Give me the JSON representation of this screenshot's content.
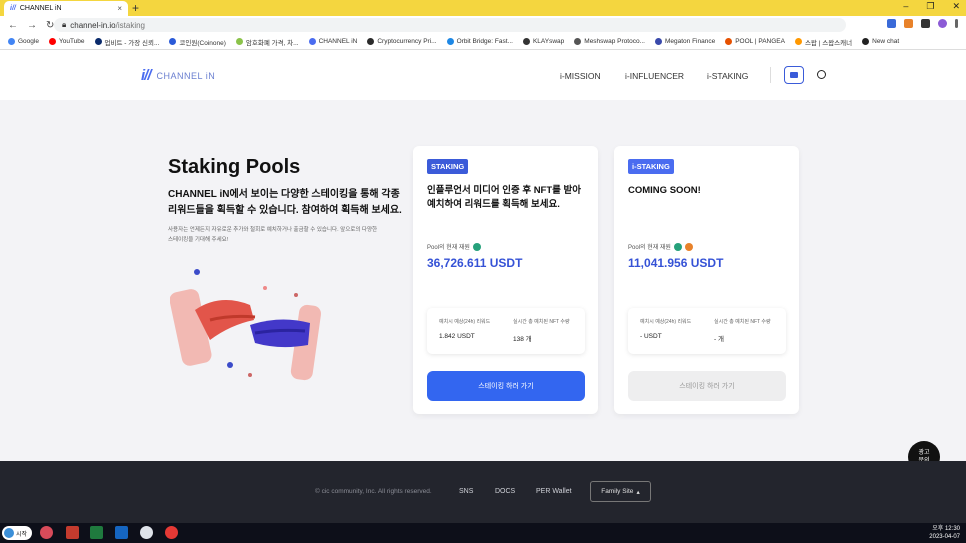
{
  "browser": {
    "tab_title": "CHANNEL iN",
    "tab_close": "×",
    "new_tab": "+",
    "url_host": "channel-in.io",
    "url_path": "/istaking",
    "bookmarks": [
      "Google",
      "YouTube",
      "업비트 - 가장 신뢰...",
      "코인원(Coinone)",
      "암호화폐 가격, 차...",
      "CHANNEL iN",
      "Cryptocurrency Pri...",
      "Orbit Bridge: Fast...",
      "KLAYswap",
      "Meshswap Protoco...",
      "Megaton Finance",
      "POOL | PANGEA",
      "스왑 | 스왑스캐너",
      "New chat"
    ]
  },
  "header": {
    "logo_mark": "i//",
    "logo_text": "CHANNEL iN",
    "nav": [
      "i-MISSION",
      "i-INFLUENCER",
      "i-STAKING"
    ]
  },
  "hero": {
    "title": "Staking Pools",
    "subtitle": "CHANNEL iN에서 보이는 다양한 스테이킹을 통해 각종 리워드들을 획득할 수 있습니다. 참여하여 획득해 보세요.",
    "note": "사용자는 언제든지 자유로운 추가와 철회로 예치하거나 출금할 수 있습니다. 앞으로의 다양한 스테이킹을 기대해 주세요!"
  },
  "cards": [
    {
      "badge": "STAKING",
      "badge_color": "#3b5bd9",
      "heading": "인플루언서 미디어 인증 후 NFT를 받아 예치하여 리워드를 획득해 보세요.",
      "pool_label": "Pool의 현재 재원",
      "amount": "36,726.611 USDT",
      "stat1_label": "예치시 예상(24h) 리워드",
      "stat1_value": "1.842 USDT",
      "stat2_label": "실시간 총 예치된 NFT 수량",
      "stat2_value": "138 개",
      "cta": "스테이킹 하러 가기"
    },
    {
      "badge": "i-STAKING",
      "badge_color": "#4a6cf0",
      "heading": "COMING SOON!",
      "pool_label": "Pool의 현재 재원",
      "amount": "11,041.956 USDT",
      "stat1_label": "예치시 예상(24h) 리워드",
      "stat1_value": "- USDT",
      "stat2_label": "실시간 총 예치된 NFT 수량",
      "stat2_value": "- 개",
      "cta": "스테이킹 하러 가기"
    }
  ],
  "ad_button": "광고 문의",
  "footer": {
    "copyright": "© cic community, Inc. All rights reserved.",
    "links": [
      "SNS",
      "DOCS",
      "PER Wallet"
    ],
    "family_site": "Family Site"
  },
  "taskbar": {
    "start": "시작",
    "time": "오후 12:30",
    "date": "2023-04-07"
  }
}
